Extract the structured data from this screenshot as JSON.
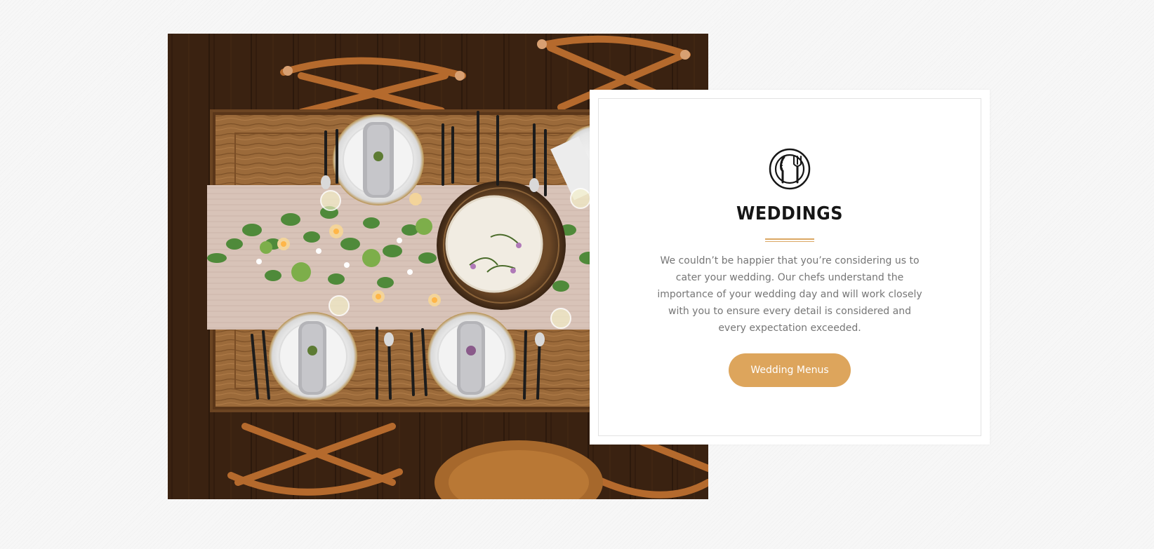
{
  "feature": {
    "image_alt": "Rustic wooden dining table set for a wedding with a cake, plates, cutlery, napkins, candles and greenery",
    "icon": "plate-cutlery-icon",
    "title": "WEDDINGS",
    "description": "We couldn’t be happier that you’re considering us to cater your wedding. Our chefs understand the importance of your wedding day and will work closely with you to ensure every detail is considered and every expectation exceeded.",
    "button_label": "Wedding Menus"
  },
  "colors": {
    "accent": "#dda55c",
    "title": "#161616",
    "body_text": "#767676",
    "page_background": "#f7f7f7"
  }
}
